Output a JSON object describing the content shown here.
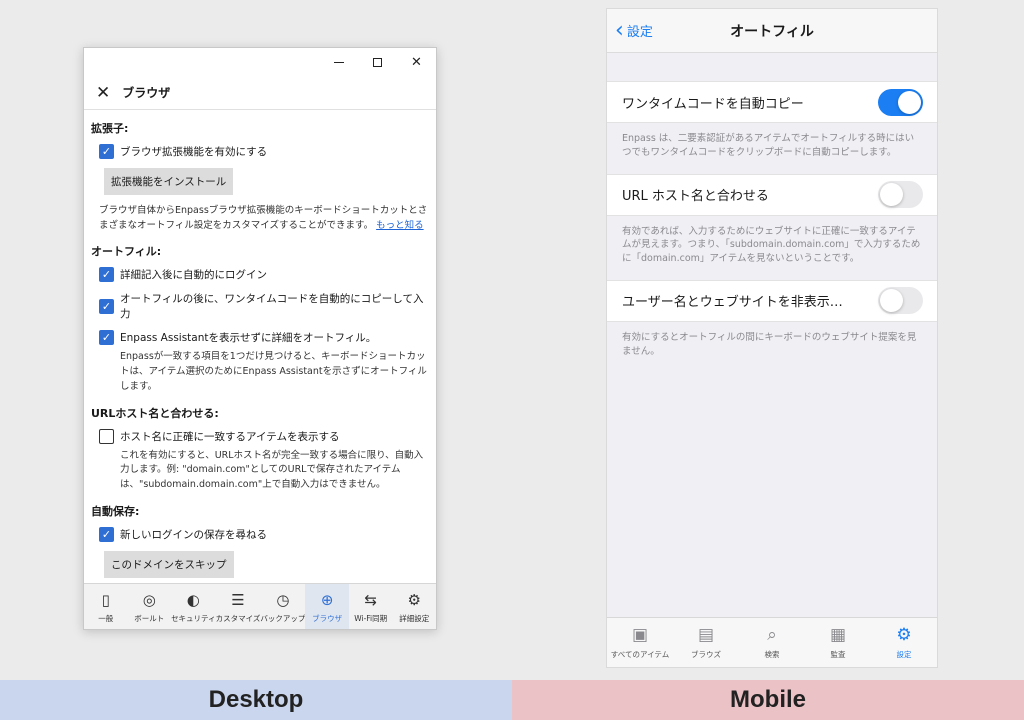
{
  "desktop": {
    "window_controls": {
      "minimize": "—",
      "maximize": "",
      "close": "✕"
    },
    "header": {
      "close": "✕",
      "title": "ブラウザ"
    },
    "sections": {
      "extensions": {
        "heading": "拡張子:",
        "enable_extension": "ブラウザ拡張機能を有効にする",
        "install_button": "拡張機能をインストール",
        "desc": "ブラウザ自体からEnpassブラウザ拡張機能のキーボードショートカットとさまざまなオートフィル設定をカスタマイズすることができます。",
        "learn_more": "もっと知る"
      },
      "autofill": {
        "heading": "オートフィル:",
        "opt1": "詳細記入後に自動的にログイン",
        "opt2": "オートフィルの後に、ワンタイムコードを自動的にコピーして入力",
        "opt3": "Enpass Assistantを表示せずに詳細をオートフィル。",
        "opt3_desc": "Enpassが一致する項目を1つだけ見つけると、キーボードショートカットは、アイテム選択のためにEnpass Assistantを示さずにオートフィルします。"
      },
      "url_match": {
        "heading": "URLホスト名と合わせる:",
        "opt": "ホスト名に正確に一致するアイテムを表示する",
        "desc": "これを有効にすると、URLホスト名が完全一致する場合に限り、自動入力します。例: \"domain.com\"としてのURLで保存されたアイテムは、\"subdomain.domain.com\"上で自動入力はできません。"
      },
      "autosave": {
        "heading": "自動保存:",
        "opt": "新しいログインの保存を尋ねる",
        "skip_button": "このドメインをスキップ"
      }
    },
    "tabs": [
      {
        "icon": "▯",
        "label": "一般"
      },
      {
        "icon": "◎",
        "label": "ボールト"
      },
      {
        "icon": "◐",
        "label": "セキュリティ"
      },
      {
        "icon": "☰",
        "label": "カスタマイズ"
      },
      {
        "icon": "◷",
        "label": "バックアップ"
      },
      {
        "icon": "⊕",
        "label": "ブラウザ"
      },
      {
        "icon": "⇆",
        "label": "Wi-Fi同期"
      },
      {
        "icon": "⚙",
        "label": "詳細設定"
      }
    ],
    "active_tab": "ブラウザ"
  },
  "mobile": {
    "nav": {
      "back": "設定",
      "title": "オートフィル"
    },
    "rows": [
      {
        "label": "ワンタイムコードを自動コピー",
        "on": true,
        "footer": "Enpass は、二要素認証があるアイテムでオートフィルする時にはいつでもワンタイムコードをクリップボードに自動コピーします。"
      },
      {
        "label": "URL ホスト名と合わせる",
        "on": false,
        "footer": "有効であれば、入力するためにウェブサイトに正確に一致するアイテムが見えます。つまり、「subdomain.domain.com」で入力するために「domain.com」アイテムを見ないということです。"
      },
      {
        "label": "ユーザー名とウェブサイトを非表示…",
        "on": false,
        "footer": "有効にするとオートフィルの間にキーボードのウェブサイト提案を見ません。"
      }
    ],
    "tabs": [
      {
        "icon": "▣",
        "label": "すべてのアイテム"
      },
      {
        "icon": "▤",
        "label": "ブラウズ"
      },
      {
        "icon": "⌕",
        "label": "検索"
      },
      {
        "icon": "▦",
        "label": "監査"
      },
      {
        "icon": "⚙",
        "label": "設定"
      }
    ],
    "active_tab": "設定"
  },
  "banners": {
    "desktop": "Desktop",
    "mobile": "Mobile"
  },
  "colors": {
    "accent_blue": "#2f6fd4",
    "ios_blue": "#1b7ef2"
  }
}
